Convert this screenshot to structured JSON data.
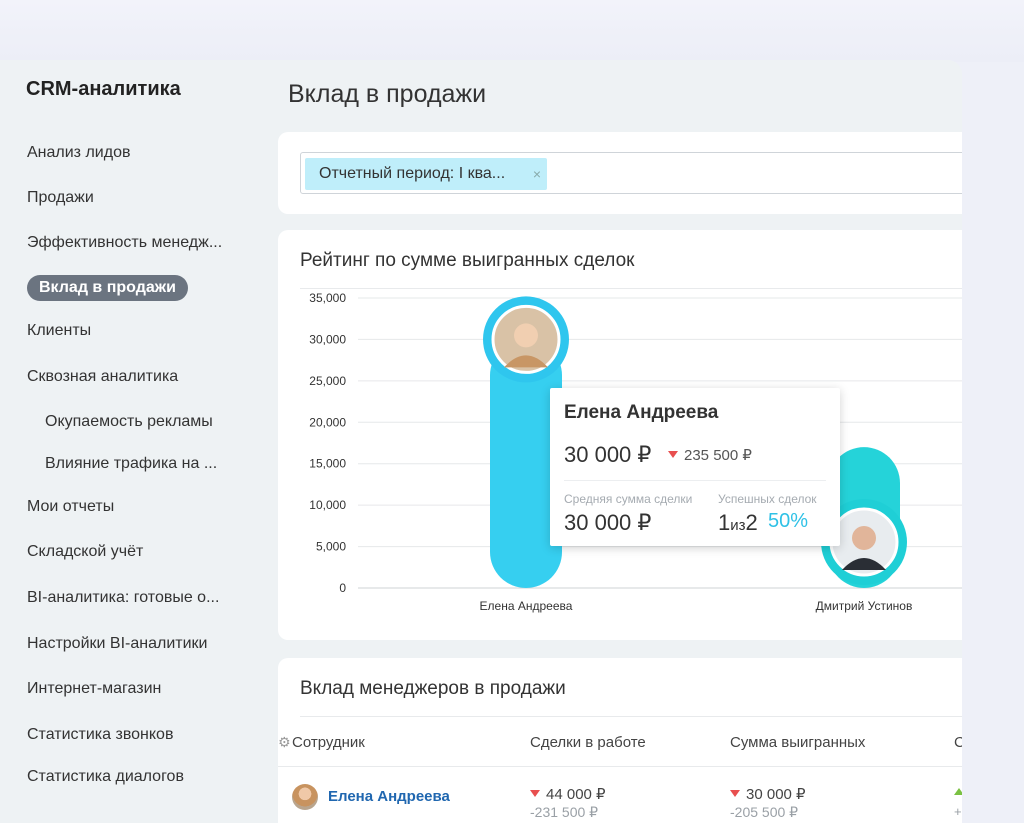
{
  "app": {
    "title": "CRM-аналитика"
  },
  "sidebar": {
    "items": [
      {
        "label": "Анализ лидов"
      },
      {
        "label": "Продажи"
      },
      {
        "label": "Эффективность менедж..."
      },
      {
        "label": "Вклад в продажи",
        "active": true
      },
      {
        "label": "Клиенты"
      },
      {
        "label": "Сквозная аналитика"
      },
      {
        "label": "Окупаемость рекламы",
        "sub": true
      },
      {
        "label": "Влияние трафика на ...",
        "sub": true
      },
      {
        "label": "Мои отчеты"
      },
      {
        "label": "Складской учёт"
      },
      {
        "label": "BI-аналитика: готовые о..."
      },
      {
        "label": "Настройки BI-аналитики"
      },
      {
        "label": "Интернет-магазин"
      },
      {
        "label": "Статистика звонков"
      },
      {
        "label": "Статистика диалогов"
      }
    ]
  },
  "page": {
    "title": "Вклад в продажи"
  },
  "filter": {
    "chip_label": "Отчетный период: I ква...",
    "close_glyph": "×"
  },
  "chart_card": {
    "title": "Рейтинг по сумме выигранных сделок"
  },
  "chart_data": {
    "type": "bar",
    "categories": [
      "Елена Андреева",
      "Дмитрий Устинов"
    ],
    "values": [
      30000,
      17000
    ],
    "ylim": [
      0,
      35000
    ],
    "yticks": [
      "0",
      "5,000",
      "10,000",
      "15,000",
      "20,000",
      "25,000",
      "30,000",
      "35,000"
    ],
    "colors": [
      "#36cff0",
      "#25d3d9"
    ],
    "ring_colors": [
      "#2fc6ee",
      "#1fcfd6"
    ],
    "grid": true
  },
  "tooltip": {
    "name": "Елена Андреева",
    "value": "30 000 ₽",
    "delta": "235 500 ₽",
    "avg_label": "Средняя сумма сделки",
    "avg_value": "30 000 ₽",
    "success_label": "Успешных сделок",
    "success_num": "1",
    "success_of": "из",
    "success_total": "2",
    "success_pct": "50%"
  },
  "table_card": {
    "title": "Вклад менеджеров в продажи",
    "columns": [
      "Сотрудник",
      "Сделки в работе",
      "Сумма выигранных",
      "С"
    ],
    "rows": [
      {
        "name": "Елена Андреева",
        "deals_in_work": "44 000 ₽",
        "deals_in_work_delta": "-231 500 ₽",
        "won_sum": "30 000 ₽",
        "won_sum_delta": "-205 500 ₽",
        "edge_sub": "+"
      }
    ]
  },
  "icons": {
    "gear": "gear-icon",
    "close": "close-icon"
  }
}
